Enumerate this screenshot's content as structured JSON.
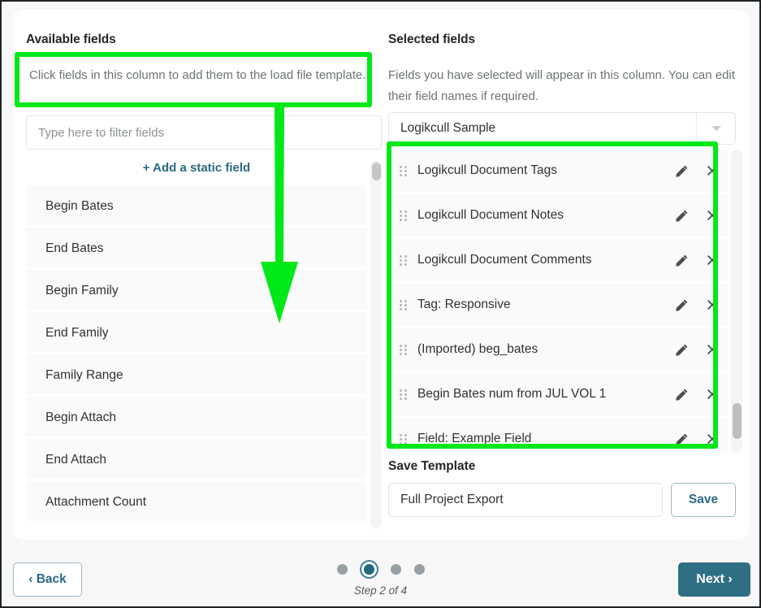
{
  "available": {
    "title": "Available fields",
    "description": "Click fields in this column to add them to the load file template.",
    "filter_placeholder": "Type here to filter fields",
    "add_static_label": "+ Add a static field",
    "fields": [
      "Begin Bates",
      "End Bates",
      "Begin Family",
      "End Family",
      "Family Range",
      "Begin Attach",
      "End Attach",
      "Attachment Count"
    ]
  },
  "selected": {
    "title": "Selected fields",
    "description": "Fields you have selected will appear in this column. You can edit their field names if required.",
    "template_dropdown_value": "Logikcull Sample",
    "fields": [
      "Logikcull Document Tags",
      "Logikcull Document Notes",
      "Logikcull Document Comments",
      "Tag: Responsive",
      "(Imported) beg_bates",
      "Begin Bates num from JUL VOL 1",
      "Field: Example Field"
    ],
    "row_icons": {
      "drag": "drag-handle-icon",
      "edit": "pencil-icon",
      "remove": "close-icon"
    }
  },
  "save_template": {
    "title": "Save Template",
    "name_value": "Full Project Export",
    "save_label": "Save"
  },
  "footer": {
    "back_label": "‹ Back",
    "next_label": "Next ›",
    "step_label": "Step 2 of 4",
    "total_steps": 4,
    "current_step": 2
  },
  "colors": {
    "accent_teal": "#2e6f86",
    "link_teal": "#2b6a82",
    "highlight_green": "#00e818",
    "row_background": "#fafafa",
    "card_background": "#ffffff",
    "page_background": "#f7f7f8"
  },
  "annotations": {
    "highlight_available_description": "green-highlight-box",
    "highlight_selected_list": "green-highlight-box",
    "arrow": "green-down-arrow"
  }
}
